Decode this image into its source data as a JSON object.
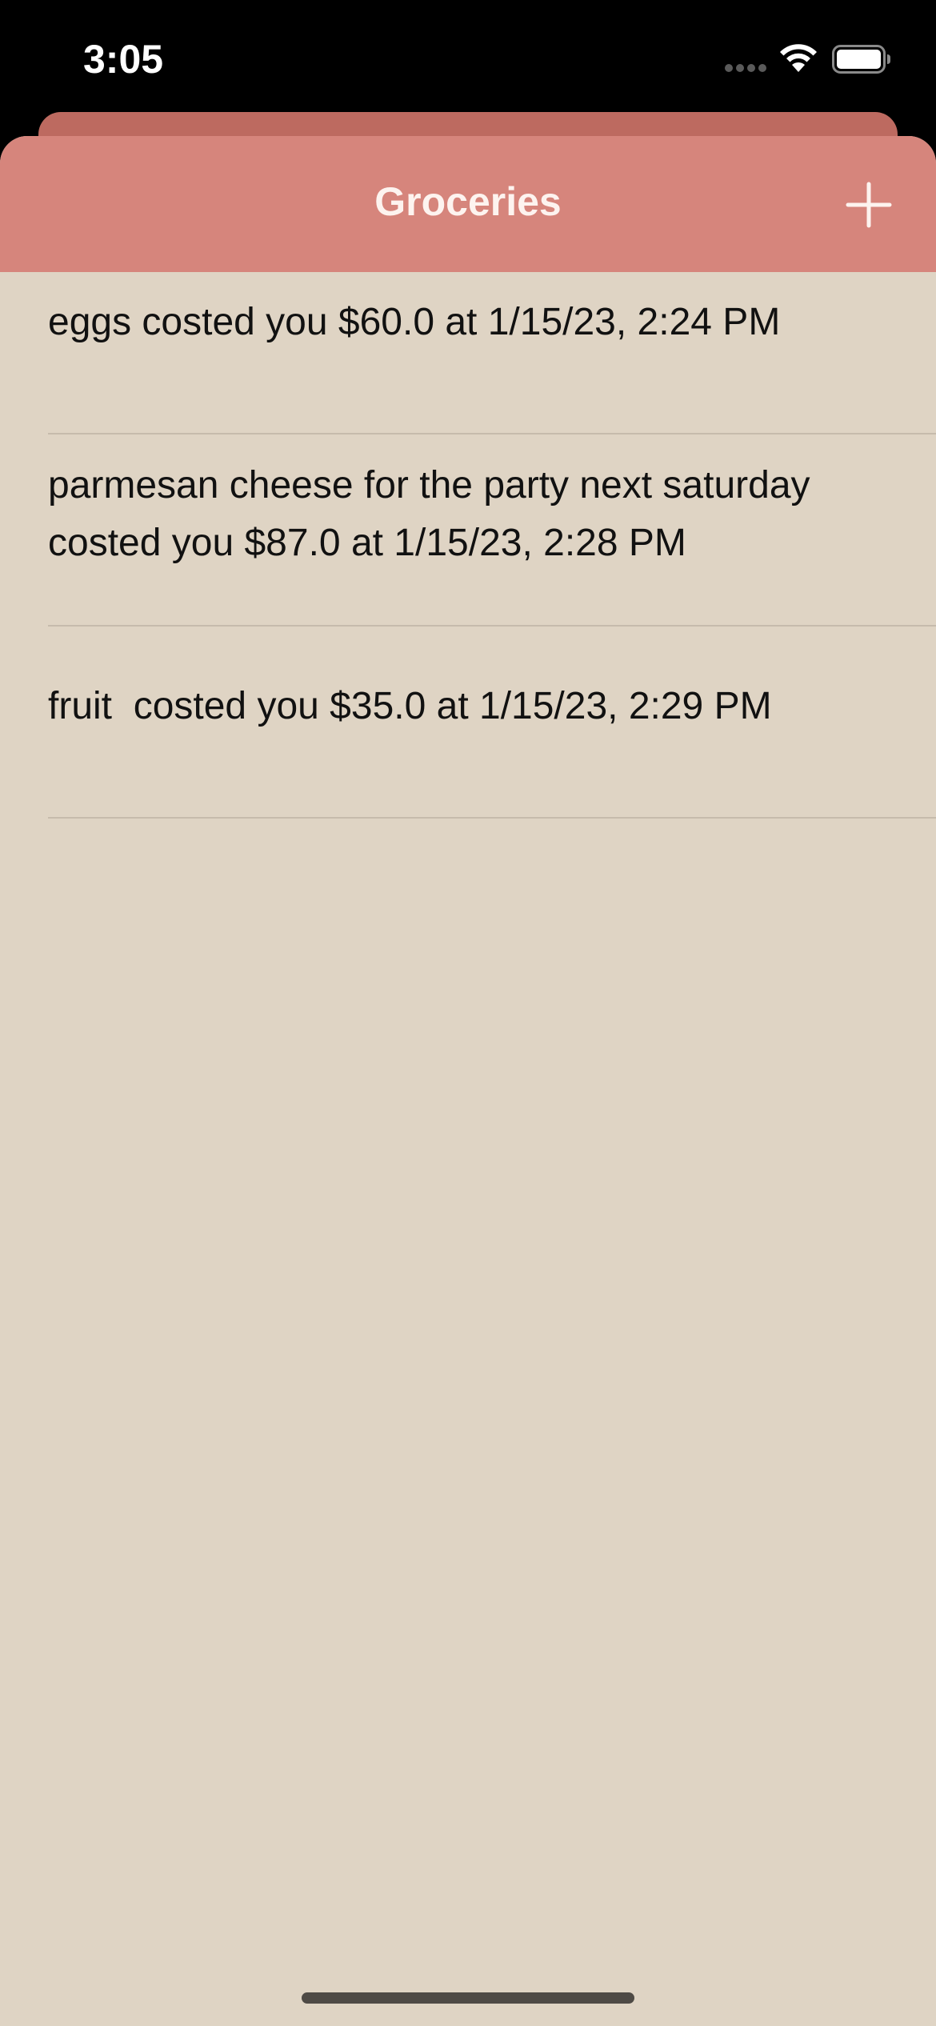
{
  "status_bar": {
    "time": "3:05",
    "icons": [
      "signal-icon",
      "wifi-icon",
      "battery-icon"
    ]
  },
  "nav": {
    "title": "Groceries",
    "add_icon": "plus-icon"
  },
  "items": [
    {
      "text": "eggs costed you $60.0 at 1/15/23, 2:24 PM"
    },
    {
      "text": "parmesan cheese for the party next saturday costed you $87.0 at 1/15/23, 2:28 PM"
    },
    {
      "text": "fruit  costed you $35.0 at 1/15/23, 2:29 PM"
    }
  ],
  "colors": {
    "header": "#d6857c",
    "header_back": "#bd6a60",
    "background": "#dfd4c4",
    "text": "#111111",
    "header_text": "#fdf3ef"
  }
}
